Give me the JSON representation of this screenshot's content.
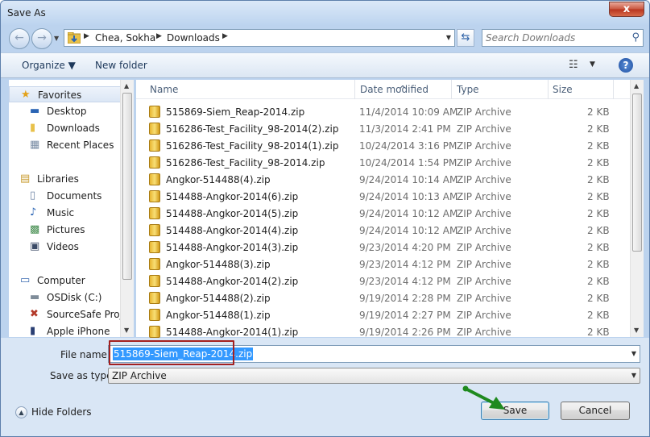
{
  "window": {
    "title": "Save As",
    "close_glyph": "x"
  },
  "address": {
    "crumbs": [
      "Chea, Sokha",
      "Downloads"
    ],
    "search_placeholder": "Search Downloads"
  },
  "toolbar": {
    "organize": "Organize ▼",
    "new_folder": "New folder",
    "help": "?"
  },
  "nav": {
    "items": [
      {
        "label": "Favorites",
        "icon": "star-icon",
        "glyph": "★",
        "color": "#e3a21a"
      },
      {
        "label": "Desktop",
        "icon": "desktop-icon",
        "glyph": "▬",
        "color": "#2a64b4"
      },
      {
        "label": "Downloads",
        "icon": "downloads-folder-icon",
        "glyph": "▮",
        "color": "#e8c14a"
      },
      {
        "label": "Recent Places",
        "icon": "recent-places-icon",
        "glyph": "▦",
        "color": "#7a8da5"
      },
      {
        "label": "Libraries",
        "icon": "libraries-icon",
        "glyph": "▤",
        "color": "#c89b2e"
      },
      {
        "label": "Documents",
        "icon": "documents-icon",
        "glyph": "▯",
        "color": "#6f86a6"
      },
      {
        "label": "Music",
        "icon": "music-icon",
        "glyph": "♪",
        "color": "#2a64b4"
      },
      {
        "label": "Pictures",
        "icon": "pictures-icon",
        "glyph": "▩",
        "color": "#3f8a4a"
      },
      {
        "label": "Videos",
        "icon": "videos-icon",
        "glyph": "▣",
        "color": "#3a4a66"
      },
      {
        "label": "Computer",
        "icon": "computer-icon",
        "glyph": "▭",
        "color": "#3a6ab0"
      },
      {
        "label": "OSDisk (C:)",
        "icon": "disk-icon",
        "glyph": "▬",
        "color": "#7f8c99"
      },
      {
        "label": "SourceSafe Proje",
        "icon": "network-drive-icon",
        "glyph": "✖",
        "color": "#b33a2a"
      },
      {
        "label": "Apple iPhone",
        "icon": "phone-icon",
        "glyph": "▮",
        "color": "#2a3f73"
      }
    ]
  },
  "columns": {
    "name": "Name",
    "date": "Date modified",
    "type": "Type",
    "size": "Size"
  },
  "files": [
    {
      "name": "515869-Siem_Reap-2014.zip",
      "date": "11/4/2014 10:09 AM",
      "type": "ZIP Archive",
      "size": "2 KB"
    },
    {
      "name": "516286-Test_Facility_98-2014(2).zip",
      "date": "11/3/2014 2:41 PM",
      "type": "ZIP Archive",
      "size": "2 KB"
    },
    {
      "name": "516286-Test_Facility_98-2014(1).zip",
      "date": "10/24/2014 3:16 PM",
      "type": "ZIP Archive",
      "size": "2 KB"
    },
    {
      "name": "516286-Test_Facility_98-2014.zip",
      "date": "10/24/2014 1:54 PM",
      "type": "ZIP Archive",
      "size": "2 KB"
    },
    {
      "name": "Angkor-514488(4).zip",
      "date": "9/24/2014 10:14 AM",
      "type": "ZIP Archive",
      "size": "2 KB"
    },
    {
      "name": "514488-Angkor-2014(6).zip",
      "date": "9/24/2014 10:13 AM",
      "type": "ZIP Archive",
      "size": "2 KB"
    },
    {
      "name": "514488-Angkor-2014(5).zip",
      "date": "9/24/2014 10:12 AM",
      "type": "ZIP Archive",
      "size": "2 KB"
    },
    {
      "name": "514488-Angkor-2014(4).zip",
      "date": "9/24/2014 10:12 AM",
      "type": "ZIP Archive",
      "size": "2 KB"
    },
    {
      "name": "514488-Angkor-2014(3).zip",
      "date": "9/23/2014 4:20 PM",
      "type": "ZIP Archive",
      "size": "2 KB"
    },
    {
      "name": "Angkor-514488(3).zip",
      "date": "9/23/2014 4:12 PM",
      "type": "ZIP Archive",
      "size": "2 KB"
    },
    {
      "name": "514488-Angkor-2014(2).zip",
      "date": "9/23/2014 4:12 PM",
      "type": "ZIP Archive",
      "size": "2 KB"
    },
    {
      "name": "Angkor-514488(2).zip",
      "date": "9/19/2014 2:28 PM",
      "type": "ZIP Archive",
      "size": "2 KB"
    },
    {
      "name": "Angkor-514488(1).zip",
      "date": "9/19/2014 2:27 PM",
      "type": "ZIP Archive",
      "size": "2 KB"
    },
    {
      "name": "514488-Angkor-2014(1).zip",
      "date": "9/19/2014 2:26 PM",
      "type": "ZIP Archive",
      "size": "2 KB"
    }
  ],
  "form": {
    "file_name_label": "File name:",
    "file_name_value": "515869-Siem_Reap-2014.zip",
    "save_type_label": "Save as type:",
    "save_type_value": "ZIP Archive"
  },
  "footer": {
    "hide_folders": "Hide Folders",
    "save": "Save",
    "cancel": "Cancel"
  },
  "colors": {
    "highlight_box": "#a32020",
    "annotation_arrow": "#1f8a1f",
    "selection": "#3399ff"
  }
}
